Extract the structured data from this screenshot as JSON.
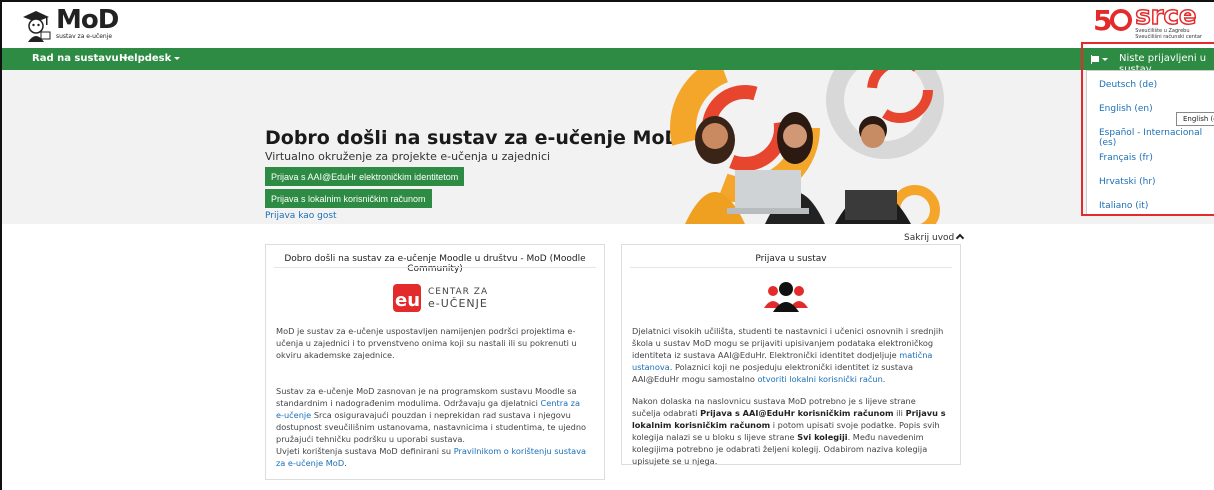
{
  "header": {
    "logo_title": "MoD",
    "logo_subtitle": "sustav za e-učenje",
    "srce_word": "srce",
    "srce_sub_1": "Sveučilište u Zagrebu",
    "srce_sub_2": "Sveučilišni računski centar"
  },
  "navbar": {
    "items": [
      {
        "label": "Rad na sustavu"
      },
      {
        "label": "Helpdesk"
      }
    ],
    "login_status": "Niste prijavljeni u sustav."
  },
  "language_menu": {
    "items": [
      {
        "label": "Deutsch (de)"
      },
      {
        "label": "English (en)"
      },
      {
        "label": "Español - Internacional (es)"
      },
      {
        "label": "Français (fr)"
      },
      {
        "label": "Hrvatski (hr)"
      },
      {
        "label": "Italiano (it)"
      }
    ],
    "tooltip": "English (en)"
  },
  "hero": {
    "title": "Dobro došli na sustav za e-učenje MoD",
    "subtitle": "Virtualno okruženje za projekte e-učenja u zajednici",
    "btn_aai": "Prijava s AAI@EduHr elektroničkim identitetom",
    "btn_local": "Prijava s lokalnim korisničkim računom",
    "guest_link": "Prijava kao gost"
  },
  "hide_intro": "Sakrij uvod",
  "card_left": {
    "title": "Dobro došli na sustav za e-učenje Moodle u društvu - MoD (Moodle Community)",
    "logo_line1": "CENTAR ZA",
    "logo_line2": "e-UČENJE",
    "p1": "MoD je sustav za e-učenje uspostavljen namijenjen podršci projektima e-učenja u zajednici i to prvenstveno onima koji su nastali ili su pokrenuti u okviru akademske zajednice.",
    "p2_a": "Sustav za e-učenje MoD zasnovan je na programskom sustavu Moodle sa standardnim i nadograđenim modulima. Održavaju ga djelatnici ",
    "p2_link": "Centra za e-učenje",
    "p2_b": " Srca osiguravajući pouzdan i neprekidan rad sustava i njegovu dostupnost sveučilišnim ustanovama, nastavnicima i studentima, te ujedno pružajući tehničku podršku u uporabi sustava.",
    "p3_a": "Uvjeti korištenja sustava MoD definirani su ",
    "p3_link": "Pravilnikom o korištenju sustava za e-učenje MoD",
    "p3_b": "."
  },
  "card_right": {
    "title": "Prijava u sustav",
    "p1_a": "Djelatnici visokih učilišta, studenti te nastavnici i učenici osnovnih i srednjih škola u sustav MoD mogu se prijaviti upisivanjem podataka elektroničkog identiteta iz sustava AAI@EduHr. Elektronički identitet dodjeljuje ",
    "p1_link1": "matična ustanova",
    "p1_b": ". Polaznici koji ne posjeduju elektronički identitet iz sustava AAI@EduHr mogu samostalno ",
    "p1_link2": "otvoriti lokalni korisnički račun",
    "p1_c": ".",
    "p2_a": "Nakon dolaska na naslovnicu sustava MoD potrebno je s lijeve strane sučelja odabrati ",
    "p2_b1": "Prijava s AAI@EduHr korisničkim računom",
    "p2_c": " ili ",
    "p2_b2": "Prijavu s lokalnim korisničkim računom",
    "p2_d": " i potom upisati svoje podatke. Popis svih kolegija nalazi se u bloku s lijeve strane ",
    "p2_b3": "Svi kolegiji",
    "p2_e": ". Među navedenim kolegijima potrebno je odabrati željeni kolegij. Odabirom naziva kolegija upisujete se u njega."
  },
  "colors": {
    "brand_green": "#2e8b44",
    "accent_red": "#e32b2b",
    "link_blue": "#1a6fb7"
  }
}
